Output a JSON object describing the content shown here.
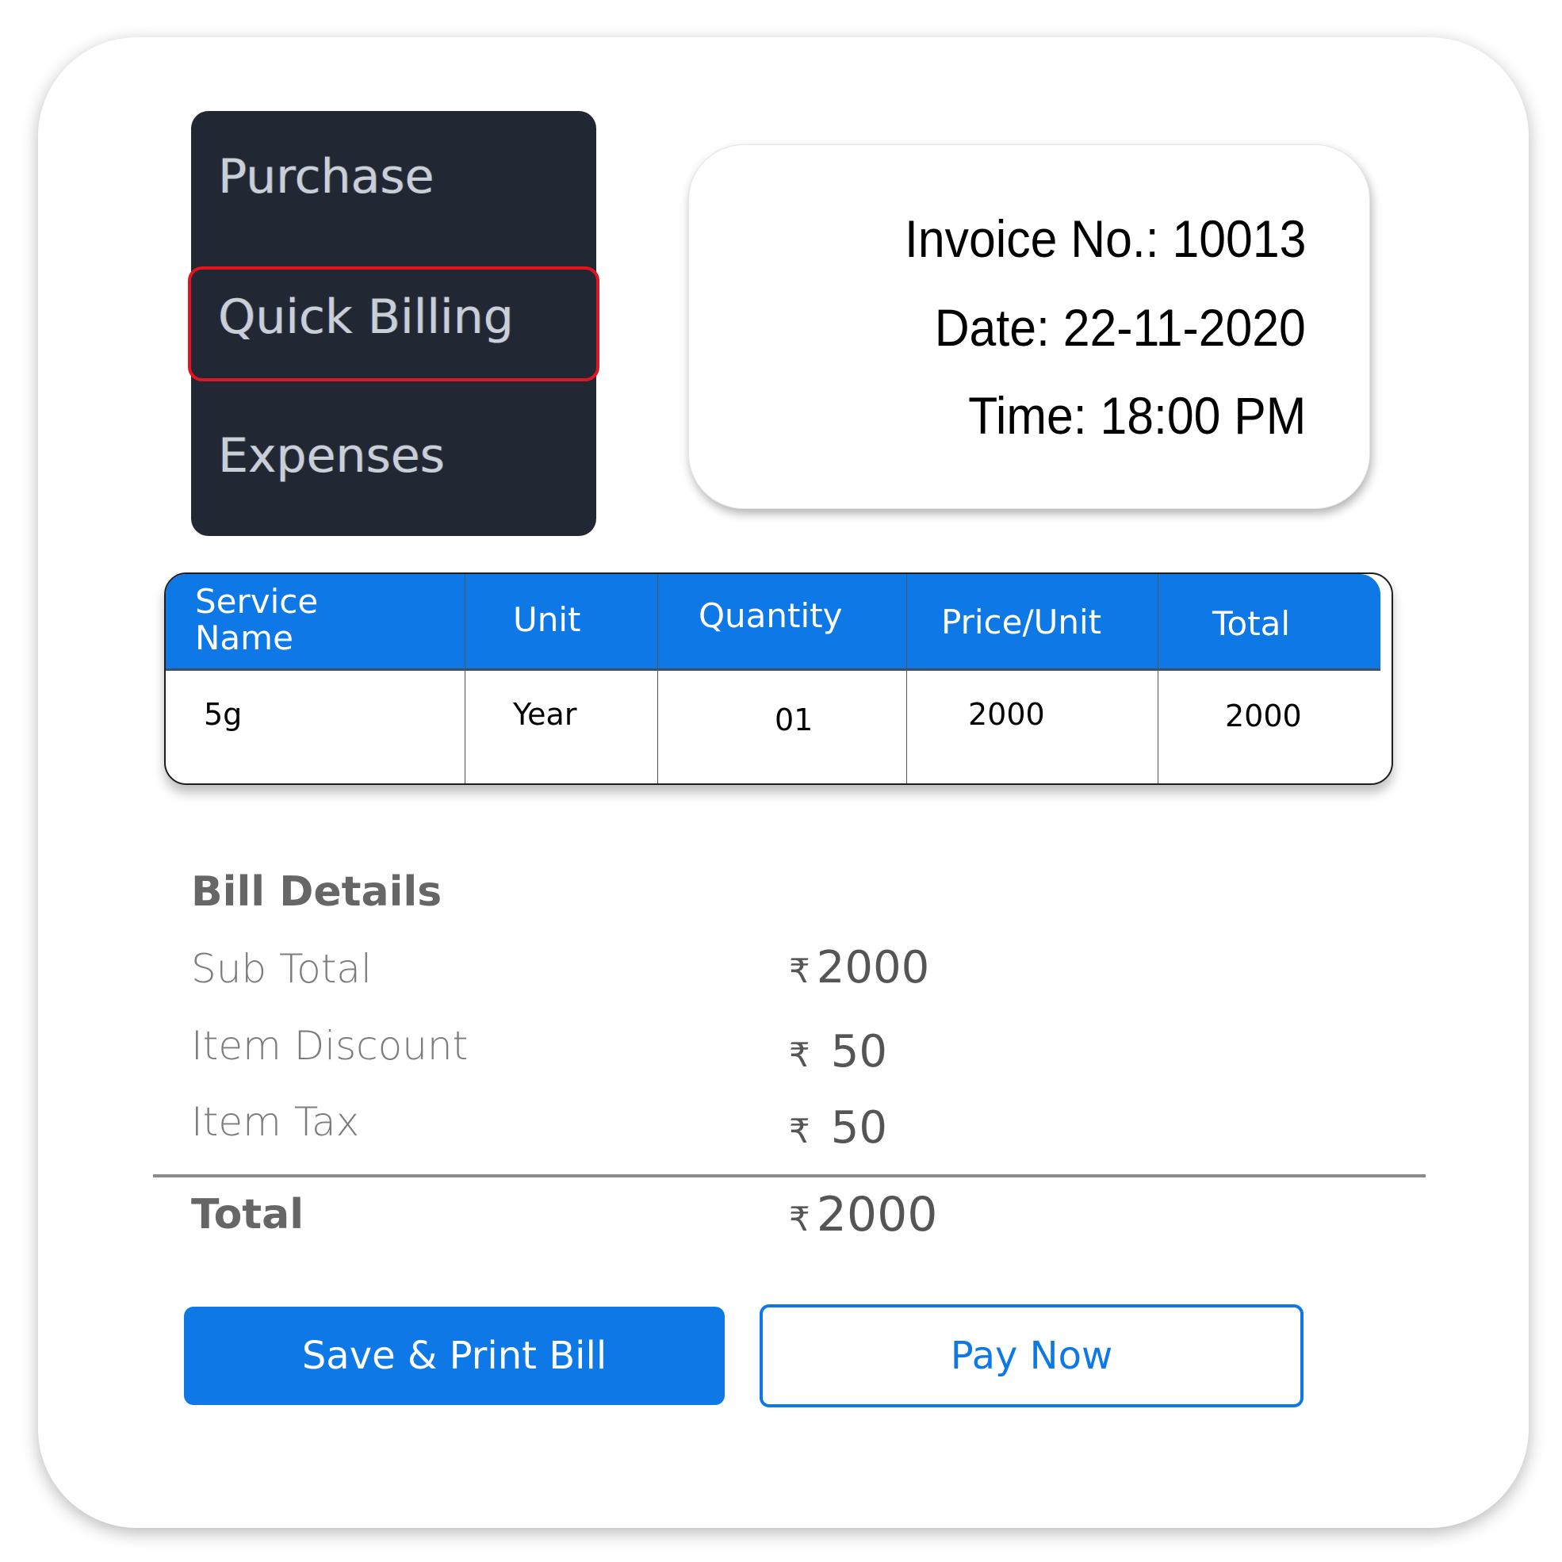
{
  "menu": {
    "items": [
      {
        "label": "Purchase"
      },
      {
        "label": "Quick Billing",
        "highlighted": true
      },
      {
        "label": "Expenses"
      }
    ],
    "highlight_color": "#e3141f"
  },
  "invoice": {
    "number_line": "Invoice No.: 10013",
    "date_line": "Date: 22-11-2020",
    "time_line": "Time: 18:00 PM"
  },
  "table": {
    "headers": [
      "Service Name",
      "Unit",
      "Quantity",
      "Price/Unit",
      "Total"
    ],
    "header_service_line1": "Service",
    "header_service_line2": "Name",
    "rows": [
      {
        "service": "5g",
        "unit": "Year",
        "quantity": "01",
        "price": "2000",
        "total": "2000"
      }
    ]
  },
  "bill": {
    "title": "Bill Details",
    "currency_symbol": "₹",
    "rows": [
      {
        "label": "Sub Total",
        "value": "2000"
      },
      {
        "label": "Item Discount",
        "value": "50"
      },
      {
        "label": "Item Tax",
        "value": "50"
      }
    ],
    "total_label": "Total",
    "total_value": "2000"
  },
  "buttons": {
    "save_print": "Save & Print Bill",
    "pay_now": "Pay Now"
  },
  "colors": {
    "accent": "#0d78e6",
    "menu_bg": "#212733"
  }
}
